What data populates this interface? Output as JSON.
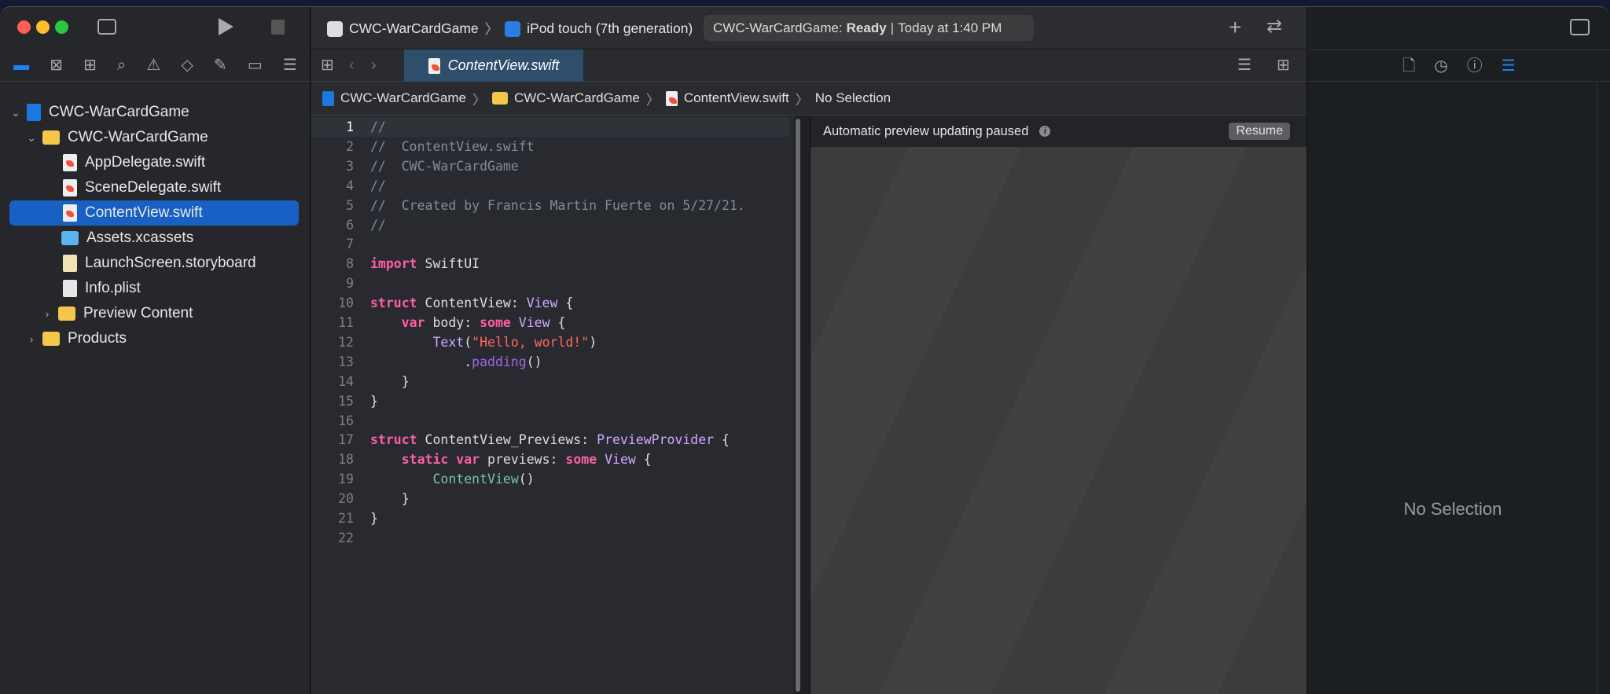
{
  "toolbar": {
    "scheme": "CWC-WarCardGame",
    "destination": "iPod touch (7th generation)",
    "status_project": "CWC-WarCardGame:",
    "status_state": "Ready",
    "status_time": "Today at 1:40 PM"
  },
  "navigator": {
    "tree": [
      {
        "label": "CWC-WarCardGame",
        "icon": "project-icon",
        "level": 0,
        "expanded": true
      },
      {
        "label": "CWC-WarCardGame",
        "icon": "folder-icon",
        "level": 1,
        "expanded": true
      },
      {
        "label": "AppDelegate.swift",
        "icon": "swift-file-icon",
        "level": 2
      },
      {
        "label": "SceneDelegate.swift",
        "icon": "swift-file-icon",
        "level": 2
      },
      {
        "label": "ContentView.swift",
        "icon": "swift-file-icon",
        "level": 2,
        "selected": true
      },
      {
        "label": "Assets.xcassets",
        "icon": "assets-icon",
        "level": 2
      },
      {
        "label": "LaunchScreen.storyboard",
        "icon": "storyboard-icon",
        "level": 2
      },
      {
        "label": "Info.plist",
        "icon": "plist-icon",
        "level": 2
      },
      {
        "label": "Preview Content",
        "icon": "folder-icon",
        "level": 2,
        "expanded": false
      },
      {
        "label": "Products",
        "icon": "folder-icon",
        "level": 1,
        "expanded": false
      }
    ]
  },
  "editor": {
    "tab": "ContentView.swift",
    "breadcrumb": [
      "CWC-WarCardGame",
      "CWC-WarCardGame",
      "ContentView.swift",
      "No Selection"
    ],
    "current_line": 1,
    "lines": [
      "//",
      "//  ContentView.swift",
      "//  CWC-WarCardGame",
      "//",
      "//  Created by Francis Martin Fuerte on 5/27/21.",
      "//",
      "",
      "import SwiftUI",
      "",
      "struct ContentView: View {",
      "    var body: some View {",
      "        Text(\"Hello, world!\")",
      "            .padding()",
      "    }",
      "}",
      "",
      "struct ContentView_Previews: PreviewProvider {",
      "    static var previews: some View {",
      "        ContentView()",
      "    }",
      "}",
      ""
    ]
  },
  "preview": {
    "message": "Automatic preview updating paused",
    "resume_label": "Resume"
  },
  "inspector": {
    "empty_label": "No Selection"
  },
  "colors": {
    "accent": "#1860c4",
    "keyword": "#fc5fa3",
    "type": "#d0a8ff",
    "string": "#fc6a5d",
    "comment": "#7f8c98"
  }
}
